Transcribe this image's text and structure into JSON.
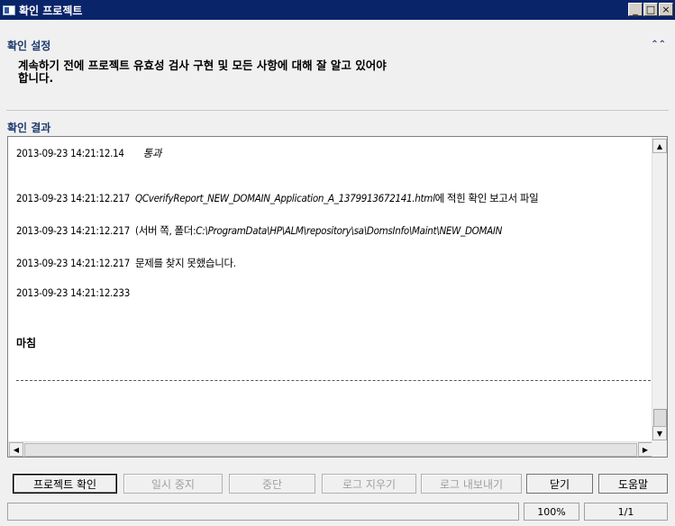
{
  "window": {
    "title": "확인 프로젝트",
    "minimize": "_",
    "maximize": "□",
    "close": "×"
  },
  "settings": {
    "heading": "확인 설정",
    "description_line1": "계속하기 전에 프로젝트 유효성 검사 구현 및 모든 사항에 대해 잘 알고 있어야",
    "description_line2": "합니다."
  },
  "results": {
    "heading": "확인 결과",
    "log": [
      {
        "timestamp": "2013-09-23 14:21:12.14",
        "text_plain": "",
        "text_italic": "통과",
        "text_after": ""
      },
      {
        "timestamp": "2013-09-23 14:21:12.217",
        "text_plain": "",
        "text_italic": "QCverifyReport_NEW_DOMAIN_Application_A_1379913672141.html",
        "text_after": "에 적힌 확인 보고서 파일"
      },
      {
        "timestamp": "2013-09-23 14:21:12.217",
        "text_plain": "(서버 쪽, 폴더:",
        "text_italic": "C:\\ProgramData\\HP\\ALM\\repository\\sa\\DomsInfo\\Maint\\NEW_DOMAIN",
        "text_after": ""
      },
      {
        "timestamp": "2013-09-23 14:21:12.217",
        "text_plain": "문제를 찾지 못했습니다.",
        "text_italic": "",
        "text_after": ""
      },
      {
        "timestamp": "2013-09-23 14:21:12.233",
        "text_plain": "",
        "text_italic": "",
        "text_after": ""
      }
    ],
    "done_label": "마침"
  },
  "buttons": {
    "verify": "프로젝트 확인",
    "pause": "일시 중지",
    "stop": "중단",
    "clear_log": "로그 지우기",
    "export_log": "로그 내보내기",
    "close": "닫기",
    "help": "도움말"
  },
  "status": {
    "zoom": "100%",
    "page": "1/1"
  },
  "colors": {
    "titlebar": "#0a246a",
    "section_heading": "#1e3a6e"
  }
}
